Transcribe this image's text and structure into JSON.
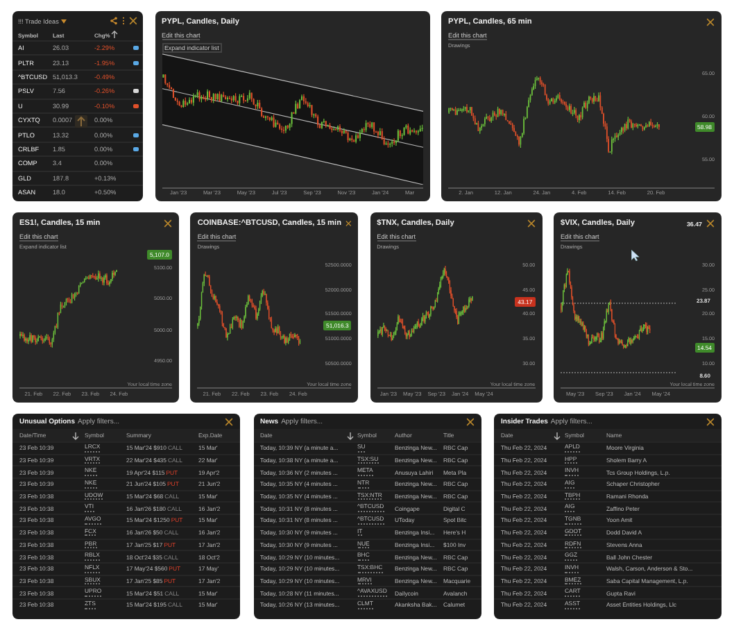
{
  "trade_ideas": {
    "title": "!!! Trade Ideas",
    "columns": [
      "Symbol",
      "Last",
      "Chg%"
    ],
    "rows": [
      {
        "symbol": "AI",
        "last": "26.03",
        "change": "-2.29%",
        "negative": true,
        "color": "#5aa9e6"
      },
      {
        "symbol": "PLTR",
        "last": "23.13",
        "change": "-1.95%",
        "negative": true,
        "color": "#5aa9e6"
      },
      {
        "symbol": "^BTCUSD",
        "last": "51,013.3",
        "change": "-0.49%",
        "negative": true
      },
      {
        "symbol": "PSLV",
        "last": "7.56",
        "change": "-0.26%",
        "negative": true,
        "color": "#d8d8d8"
      },
      {
        "symbol": "U",
        "last": "30.99",
        "change": "-0.10%",
        "negative": true,
        "color": "#e0502a"
      },
      {
        "symbol": "CYXTQ",
        "last": "0.0007",
        "change": "0.00%",
        "negative": false,
        "highlight": true
      },
      {
        "symbol": "PTLO",
        "last": "13.32",
        "change": "0.00%",
        "negative": false,
        "color": "#5aa9e6"
      },
      {
        "symbol": "CRLBF",
        "last": "1.85",
        "change": "0.00%",
        "negative": false,
        "color": "#5aa9e6"
      },
      {
        "symbol": "COMP",
        "last": "3.4",
        "change": "0.00%",
        "negative": false
      },
      {
        "symbol": "GLD",
        "last": "187.8",
        "change": "+0.13%",
        "negative": false
      },
      {
        "symbol": "ASAN",
        "last": "18.0",
        "change": "+0.50%",
        "negative": false
      }
    ]
  },
  "charts": [
    {
      "title": "PYPL, Candles, Daily",
      "edit_link": "Edit this chart",
      "extra": {
        "text": "Expand indicator list",
        "kind": "button"
      },
      "channel": true,
      "x_ticks": [
        "Jan '23",
        "Mar '23",
        "May '23",
        "Jul '23",
        "Sep '23",
        "Nov '23",
        "Jan '24",
        "Mar"
      ]
    },
    {
      "title": "PYPL, Candles, 65 min",
      "edit_link": "Edit this chart",
      "extra": {
        "text": "Drawings",
        "kind": "label"
      },
      "closable": true,
      "y_ticks": [
        "65.00",
        "60.00",
        "55.00"
      ],
      "badge": {
        "text": "58.98",
        "negative": false
      },
      "x_ticks": [
        "2. Jan",
        "12. Jan",
        "24. Jan",
        "4. Feb",
        "14. Feb",
        "20. Feb"
      ]
    },
    {
      "title": "ES1!, Candles, 15 min",
      "edit_link": "Edit this chart",
      "extra": {
        "text": "Expand indicator list",
        "kind": "label"
      },
      "closable": true,
      "y_ticks": [
        "5100.00",
        "5050.00",
        "5000.00",
        "4950.00"
      ],
      "badge": {
        "text": "5,107.0",
        "negative": false
      },
      "footer": "Your local time zone",
      "x_ticks": [
        "21. Feb",
        "22. Feb",
        "23. Feb",
        "24. Feb"
      ]
    },
    {
      "title": "COINBASE:^BTCUSD, Candles, 15 min",
      "edit_link": "Edit this chart",
      "extra": {
        "text": "Drawings",
        "kind": "label"
      },
      "closable": true,
      "y_ticks": [
        "52500.0000",
        "52000.0000",
        "51500.0000",
        "51000.0000",
        "50500.0000"
      ],
      "badge": {
        "text": "51,016.3",
        "negative": false
      },
      "footer": "Your local time zone",
      "x_ticks": [
        "21. Feb",
        "22. Feb",
        "23. Feb",
        "24. Feb"
      ]
    },
    {
      "title": "$TNX, Candles, Daily",
      "edit_link": "Edit this chart",
      "extra": {
        "text": "Drawings",
        "kind": "label"
      },
      "closable": true,
      "y_ticks": [
        "50.00",
        "45.00",
        "40.00",
        "35.00",
        "30.00"
      ],
      "badge": {
        "text": "43.17",
        "negative": true
      },
      "footer": "Your local time zone",
      "x_ticks": [
        "Jan '23",
        "May '23",
        "Sep '23",
        "Jan '24",
        "May '24"
      ]
    },
    {
      "title": "$VIX, Candles, Daily",
      "top_label": "36.47",
      "edit_link": "Edit this chart",
      "extra": {
        "text": "Drawings",
        "kind": "label"
      },
      "closable": true,
      "cursor": true,
      "y_ticks": [
        "30.00",
        "25.00",
        "20.00",
        "15.00",
        "10.00"
      ],
      "level_lines": [
        "23.87",
        "8.60"
      ],
      "badge": {
        "text": "14.54",
        "negative": false
      },
      "footer": "Your local time zone",
      "x_ticks": [
        "May '23",
        "Sep '23",
        "Jan '24",
        "May '24"
      ]
    }
  ],
  "tables": [
    {
      "title": "Unusual Options",
      "filter": "Apply filters...",
      "kind": "options",
      "columns": [
        "Date/Time",
        "Symbol",
        "Summary",
        "Exp.Date"
      ],
      "rows": [
        {
          "date": "23 Feb 10:39",
          "symbol": "LRCX",
          "summary": "15 Mar'24 $910",
          "side": "CALL",
          "kind": "call",
          "exp": "15 Mar'"
        },
        {
          "date": "23 Feb 10:39",
          "symbol": "VRTX",
          "summary": "22 Mar'24 $435",
          "side": "CALL",
          "kind": "call",
          "exp": "22 Mar'"
        },
        {
          "date": "23 Feb 10:39",
          "symbol": "NKE",
          "summary": "19 Apr'24 $115",
          "side": "PUT",
          "kind": "put",
          "exp": "19 Apr'2"
        },
        {
          "date": "23 Feb 10:39",
          "symbol": "NKE",
          "summary": "21 Jun'24 $105",
          "side": "PUT",
          "kind": "put",
          "exp": "21 Jun'2"
        },
        {
          "date": "23 Feb 10:38",
          "symbol": "UDOW",
          "summary": "15 Mar'24 $68",
          "side": "CALL",
          "kind": "call",
          "exp": "15 Mar'"
        },
        {
          "date": "23 Feb 10:38",
          "symbol": "VTI",
          "summary": "16 Jan'26 $180",
          "side": "CALL",
          "kind": "call",
          "exp": "16 Jan'2"
        },
        {
          "date": "23 Feb 10:38",
          "symbol": "AVGO",
          "summary": "15 Mar'24 $1250",
          "side": "PUT",
          "kind": "put",
          "exp": "15 Mar'"
        },
        {
          "date": "23 Feb 10:38",
          "symbol": "FCX",
          "summary": "16 Jan'26 $50",
          "side": "CALL",
          "kind": "call",
          "exp": "16 Jan'2"
        },
        {
          "date": "23 Feb 10:38",
          "symbol": "PBR",
          "summary": "17 Jan'25 $17",
          "side": "PUT",
          "kind": "put",
          "exp": "17 Jan'2"
        },
        {
          "date": "23 Feb 10:38",
          "symbol": "RBLX",
          "summary": "18 Oct'24 $35",
          "side": "CALL",
          "kind": "call",
          "exp": "18 Oct'2"
        },
        {
          "date": "23 Feb 10:38",
          "symbol": "NFLX",
          "summary": "17 May'24 $560",
          "side": "PUT",
          "kind": "put",
          "exp": "17 May'"
        },
        {
          "date": "23 Feb 10:38",
          "symbol": "SBUX",
          "summary": "17 Jan'25 $85",
          "side": "PUT",
          "kind": "put",
          "exp": "17 Jan'2"
        },
        {
          "date": "23 Feb 10:38",
          "symbol": "UPRO",
          "summary": "15 Mar'24 $51",
          "side": "CALL",
          "kind": "call",
          "exp": "15 Mar'"
        },
        {
          "date": "23 Feb 10:38",
          "symbol": "ZTS",
          "summary": "15 Mar'24 $195",
          "side": "CALL",
          "kind": "call",
          "exp": "15 Mar'"
        }
      ]
    },
    {
      "title": "News",
      "filter": "Apply filters...",
      "kind": "news",
      "columns": [
        "Date",
        "Symbol",
        "Author",
        "Title"
      ],
      "rows": [
        {
          "date": "Today, 10:39 NY (a minute a...",
          "symbol": "SU",
          "author": "Benzinga New...",
          "headline": "RBC Cap"
        },
        {
          "date": "Today, 10:38 NY (a minute a...",
          "symbol": "TSX:SU",
          "author": "Benzinga New...",
          "headline": "RBC Cap"
        },
        {
          "date": "Today, 10:36 NY (2 minutes ...",
          "symbol": "META",
          "author": "Anusuya Lahiri",
          "headline": "Meta Pla"
        },
        {
          "date": "Today, 10:35 NY (4 minutes ...",
          "symbol": "NTR",
          "author": "Benzinga New...",
          "headline": "RBC Cap"
        },
        {
          "date": "Today, 10:35 NY (4 minutes ...",
          "symbol": "TSX:NTR",
          "author": "Benzinga New...",
          "headline": "RBC Cap"
        },
        {
          "date": "Today, 10:31 NY (8 minutes ...",
          "symbol": "^BTCUSD",
          "author": "Coingape",
          "headline": "Digital C"
        },
        {
          "date": "Today, 10:31 NY (8 minutes ...",
          "symbol": "^BTCUSD",
          "author": "UToday",
          "headline": "Spot Bitc"
        },
        {
          "date": "Today, 10:30 NY (9 minutes ...",
          "symbol": "IT",
          "author": "Benzinga Insi...",
          "headline": "Here's H"
        },
        {
          "date": "Today, 10:30 NY (9 minutes ...",
          "symbol": "NUE",
          "author": "Benzinga Insi...",
          "headline": "$100 Inv"
        },
        {
          "date": "Today, 10:29 NY (10 minutes...",
          "symbol": "BHC",
          "author": "Benzinga New...",
          "headline": "RBC Cap"
        },
        {
          "date": "Today, 10:29 NY (10 minutes...",
          "symbol": "TSX:BHC",
          "author": "Benzinga New...",
          "headline": "RBC Cap"
        },
        {
          "date": "Today, 10:29 NY (10 minutes...",
          "symbol": "MRVI",
          "author": "Benzinga New...",
          "headline": "Macquarie"
        },
        {
          "date": "Today, 10:28 NY (11 minutes...",
          "symbol": "^AVAXUSD",
          "author": "Dailycoin",
          "headline": "Avalanch"
        },
        {
          "date": "Today, 10:26 NY (13 minutes...",
          "symbol": "CLMT",
          "author": "Akanksha Bak...",
          "headline": "Calumet"
        }
      ]
    },
    {
      "title": "Insider Trades",
      "filter": "Apply filters...",
      "kind": "insider",
      "columns": [
        "Date",
        "Symbol",
        "Name"
      ],
      "rows": [
        {
          "date": "Thu Feb 22, 2024",
          "symbol": "APLD",
          "name": "Moore Virginia"
        },
        {
          "date": "Thu Feb 22, 2024",
          "symbol": "HPP",
          "name": "Sholem Barry A"
        },
        {
          "date": "Thu Feb 22, 2024",
          "symbol": "INVH",
          "name": "Tcs Group Holdings, L.p."
        },
        {
          "date": "Thu Feb 22, 2024",
          "symbol": "AIG",
          "name": "Schaper Christopher"
        },
        {
          "date": "Thu Feb 22, 2024",
          "symbol": "TBPH",
          "name": "Ramani Rhonda"
        },
        {
          "date": "Thu Feb 22, 2024",
          "symbol": "AIG",
          "name": "Zaffino Peter"
        },
        {
          "date": "Thu Feb 22, 2024",
          "symbol": "TGNB",
          "name": "Yoon Amit"
        },
        {
          "date": "Thu Feb 22, 2024",
          "symbol": "GDOT",
          "name": "Dodd David A"
        },
        {
          "date": "Thu Feb 22, 2024",
          "symbol": "RDFN",
          "name": "Stevens Anna"
        },
        {
          "date": "Thu Feb 22, 2024",
          "symbol": "GGZ",
          "name": "Ball John Chester"
        },
        {
          "date": "Thu Feb 22, 2024",
          "symbol": "INVH",
          "name": "Walsh, Carson, Anderson & Sto..."
        },
        {
          "date": "Thu Feb 22, 2024",
          "symbol": "BMEZ",
          "name": "Saba Capital Management, L.p."
        },
        {
          "date": "Thu Feb 22, 2024",
          "symbol": "CART",
          "name": "Gupta Ravi"
        },
        {
          "date": "Thu Feb 22, 2024",
          "symbol": "ASST",
          "name": "Asset Entities Holdings, Llc"
        }
      ]
    }
  ]
}
